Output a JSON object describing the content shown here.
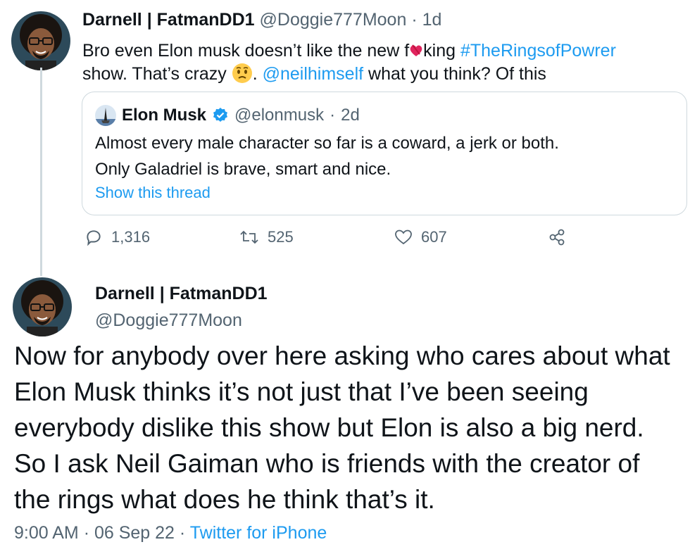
{
  "tweet1": {
    "author_name": "Darnell | FatmanDD1",
    "handle": "@Doggie777Moon",
    "separator": "·",
    "age": "1d",
    "text_1": "Bro even Elon musk doesn’t like the new f",
    "text_censor_rest": "king",
    "hashtag": "#TheRingsofPowrer",
    "text_2": "show. That’s crazy",
    "text_3": ".",
    "mention": "@neilhimself",
    "text_4": "what you think? Of this",
    "quote": {
      "author_name": "Elon Musk",
      "handle": "@elonmusk",
      "separator": "·",
      "age": "2d",
      "line1": "Almost every male character so far is a coward, a jerk or both.",
      "line2": "Only Galadriel is brave, smart and nice.",
      "show_thread": "Show this thread"
    },
    "actions": {
      "replies": "1,316",
      "retweets": "525",
      "likes": "607"
    }
  },
  "tweet2": {
    "author_name": "Darnell | FatmanDD1",
    "handle": "@Doggie777Moon",
    "text": "Now for anybody over here asking who cares about what Elon Musk thinks it’s not just that I’ve been seeing everybody dislike this show but Elon is also a big nerd. So I ask Neil Gaiman who is friends with the creator of the rings what does he think that’s it.",
    "time": "9:00 AM",
    "date": "06 Sep 22",
    "sep": "·",
    "source": "Twitter for iPhone"
  },
  "colors": {
    "link": "#1d9bf0",
    "muted": "#536471",
    "border": "#cfd9de"
  },
  "icons": [
    "reply-icon",
    "retweet-icon",
    "like-icon",
    "share-icon",
    "verified-badge-icon",
    "worried-face-emoji",
    "heart-censor-emoji"
  ]
}
